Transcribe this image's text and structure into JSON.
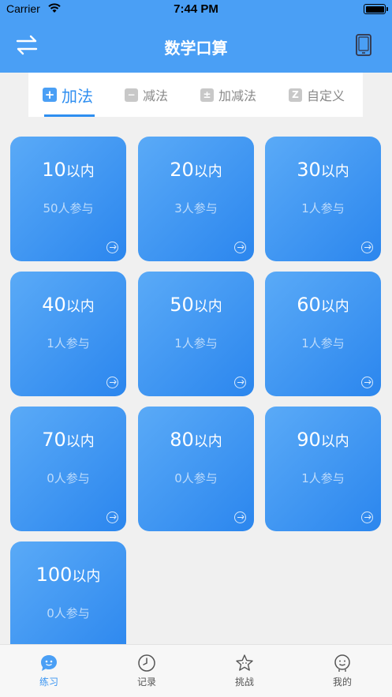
{
  "status_bar": {
    "carrier": "Carrier",
    "time": "7:44 PM"
  },
  "header": {
    "title": "数学口算",
    "left_icon": "swap-icon",
    "right_icon": "phone-icon"
  },
  "tabs": [
    {
      "label": "加法",
      "icon": "+",
      "active": true
    },
    {
      "label": "减法",
      "icon": "−",
      "active": false
    },
    {
      "label": "加减法",
      "icon": "±",
      "active": false
    },
    {
      "label": "自定义",
      "icon": "Z",
      "active": false
    }
  ],
  "cards": [
    {
      "number": "10",
      "unit": "以内",
      "participants": "50人参与"
    },
    {
      "number": "20",
      "unit": "以内",
      "participants": "3人参与"
    },
    {
      "number": "30",
      "unit": "以内",
      "participants": "1人参与"
    },
    {
      "number": "40",
      "unit": "以内",
      "participants": "1人参与"
    },
    {
      "number": "50",
      "unit": "以内",
      "participants": "1人参与"
    },
    {
      "number": "60",
      "unit": "以内",
      "participants": "1人参与"
    },
    {
      "number": "70",
      "unit": "以内",
      "participants": "0人参与"
    },
    {
      "number": "80",
      "unit": "以内",
      "participants": "0人参与"
    },
    {
      "number": "90",
      "unit": "以内",
      "participants": "1人参与"
    },
    {
      "number": "100",
      "unit": "以内",
      "participants": "0人参与"
    }
  ],
  "bottom_nav": [
    {
      "label": "练习",
      "icon": "chat-bubble-icon",
      "active": true
    },
    {
      "label": "记录",
      "icon": "clock-icon",
      "active": false
    },
    {
      "label": "挑战",
      "icon": "star-icon",
      "active": false
    },
    {
      "label": "我的",
      "icon": "smiley-icon",
      "active": false
    }
  ],
  "colors": {
    "primary": "#4a9ff5",
    "active_tab": "#2e8ef0",
    "card_start": "#5aaaf7",
    "card_end": "#2b86ee"
  }
}
